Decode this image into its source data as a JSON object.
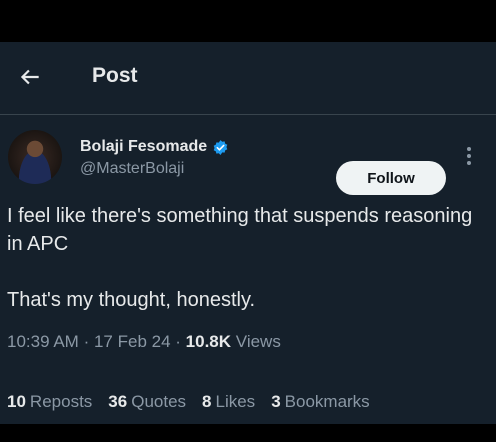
{
  "header": {
    "title": "Post",
    "back_icon": "arrow-left-icon"
  },
  "author": {
    "display_name": "Bolaji Fesomade",
    "handle": "@MasterBolaji",
    "verified_icon": "verified-badge-icon",
    "verified_color": "#1d9bf0"
  },
  "actions": {
    "follow_label": "Follow",
    "more_icon": "more-vertical-icon"
  },
  "tweet": {
    "line1": "I feel like there's something that suspends reasoning in APC",
    "line2": "That's my thought, honestly."
  },
  "meta": {
    "time": "10:39 AM",
    "sep1": "·",
    "date": "17 Feb 24",
    "sep2": "·",
    "views_count": "10.8K",
    "views_label": "Views"
  },
  "stats": [
    {
      "count": "10",
      "label": "Reposts"
    },
    {
      "count": "36",
      "label": "Quotes"
    },
    {
      "count": "8",
      "label": "Likes"
    },
    {
      "count": "3",
      "label": "Bookmarks"
    }
  ],
  "colors": {
    "background": "#15202b",
    "text": "#e7e9ea",
    "secondary": "#8b98a5",
    "border": "#38444d",
    "button": "#eff3f4"
  }
}
